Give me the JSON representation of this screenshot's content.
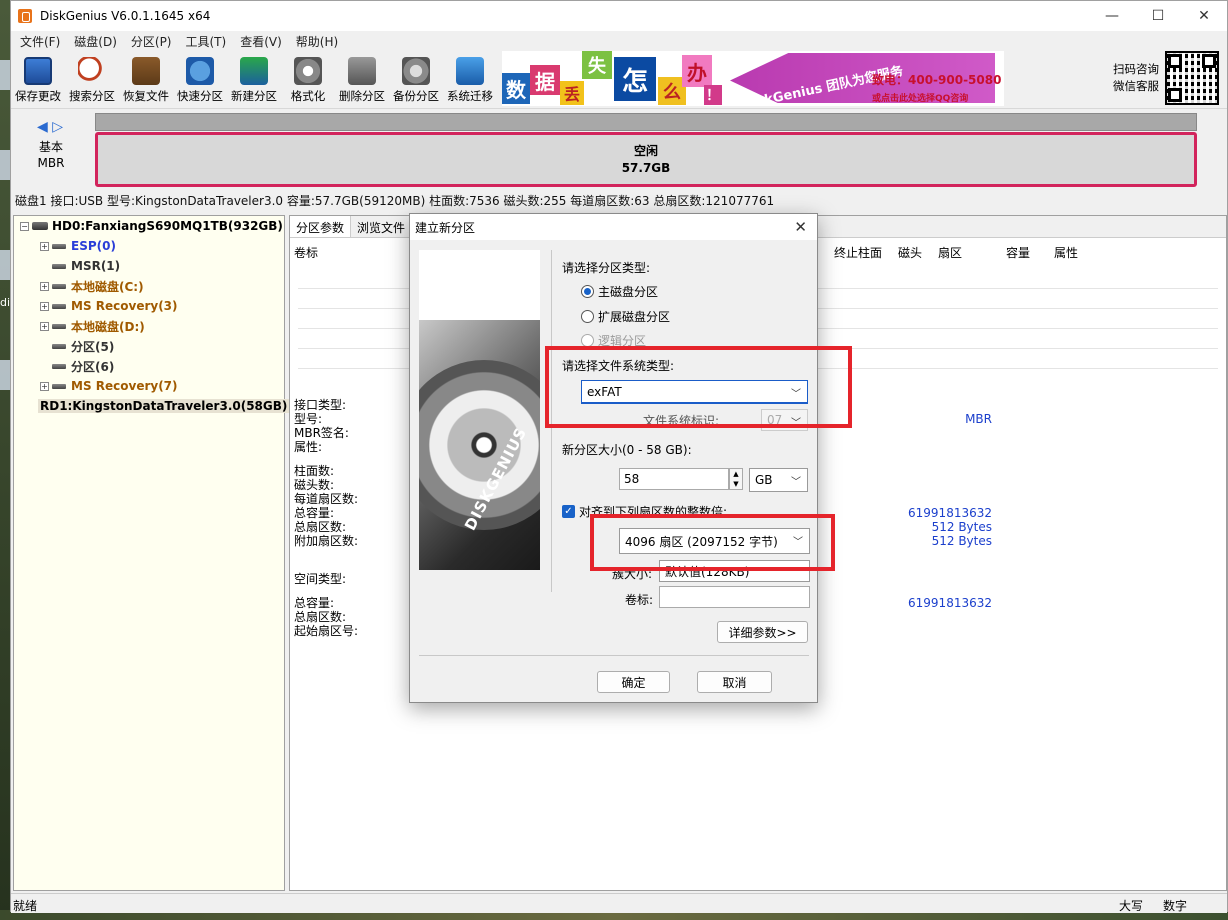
{
  "window": {
    "title": "DiskGenius V6.0.1.1645 x64"
  },
  "desktop": {
    "side_label": "di"
  },
  "window_buttons": {
    "minimize": "—",
    "maximize": "☐",
    "close": "✕"
  },
  "menu": [
    "文件(F)",
    "磁盘(D)",
    "分区(P)",
    "工具(T)",
    "查看(V)",
    "帮助(H)"
  ],
  "toolbar": [
    {
      "label": "保存更改",
      "icon": "save-icon"
    },
    {
      "label": "搜索分区",
      "icon": "search-icon"
    },
    {
      "label": "恢复文件",
      "icon": "recover-icon"
    },
    {
      "label": "快速分区",
      "icon": "quick-partition-icon"
    },
    {
      "label": "新建分区",
      "icon": "new-partition-icon"
    },
    {
      "label": "格式化",
      "icon": "format-icon"
    },
    {
      "label": "删除分区",
      "icon": "delete-icon"
    },
    {
      "label": "备份分区",
      "icon": "backup-icon"
    },
    {
      "label": "系统迁移",
      "icon": "migrate-icon"
    }
  ],
  "banner": {
    "chars": [
      "数",
      "据",
      "丢",
      "失",
      "怎",
      "么",
      "办",
      "！"
    ],
    "team": "DiskGenius 团队为您服务",
    "phone": "致电：400-900-5080",
    "qq": "或点击此处选择QQ咨询"
  },
  "qr": {
    "line1": "扫码咨询",
    "line2": "微信客服"
  },
  "diskmap": {
    "nav": "◀ ▷",
    "disk_type_line1": "基本",
    "disk_type_line2": "MBR",
    "free_label": "空闲",
    "free_size": "57.7GB"
  },
  "disk_info": "磁盘1 接口:USB  型号:KingstonDataTraveler3.0  容量:57.7GB(59120MB)  柱面数:7536  磁头数:255  每道扇区数:63  总扇区数:121077761",
  "tree": {
    "disk0": "HD0:FanxiangS690MQ1TB(932GB)",
    "partitions": [
      "ESP(0)",
      "MSR(1)",
      "本地磁盘(C:)",
      "MS Recovery(3)",
      "本地磁盘(D:)",
      "分区(5)",
      "分区(6)",
      "MS Recovery(7)"
    ],
    "disk1": "RD1:KingstonDataTraveler3.0(58GB)",
    "expander_plus": "+",
    "expander_minus": "−"
  },
  "right_panel": {
    "tabs": [
      "分区参数",
      "浏览文件"
    ],
    "columns": [
      "卷标",
      "终止柱面",
      "磁头",
      "扇区",
      "容量",
      "属性"
    ],
    "info_group1": [
      "接口类型:",
      "型号:",
      "MBR签名:",
      "属性:"
    ],
    "info_group2": [
      "柱面数:",
      "磁头数:",
      "每道扇区数:",
      "总容量:",
      "总扇区数:",
      "附加扇区数:"
    ],
    "space_type": "空间类型:",
    "info_group3": [
      "总容量:",
      "总扇区数:",
      "起始扇区号:"
    ],
    "values": {
      "mbr": "MBR",
      "total_bytes": "61991813632",
      "sector_size1": "512 Bytes",
      "sector_size2": "512 Bytes",
      "free_bytes": "61991813632"
    }
  },
  "status": {
    "left": "就绪",
    "caps": "大写",
    "num": "数字"
  },
  "dialog": {
    "title": "建立新分区",
    "close": "✕",
    "partition_type_label": "请选择分区类型:",
    "radios": [
      "主磁盘分区",
      "扩展磁盘分区",
      "逻辑分区"
    ],
    "fs_type_label": "请选择文件系统类型:",
    "fs_type_value": "exFAT",
    "fs_id_label": "文件系统标识:",
    "fs_id_value": "07",
    "size_label": "新分区大小(0 - 58 GB):",
    "size_value": "58",
    "size_unit": "GB",
    "align_label": "对齐到下列扇区数的整数倍:",
    "align_value": "4096 扇区 (2097152 字节)",
    "cluster_label": "簇大小:",
    "cluster_value": "默认值(128KB)",
    "volume_label": "卷标:",
    "volume_value": "",
    "details_button": "详细参数>>",
    "ok_button": "确定",
    "cancel_button": "取消",
    "image_text": "DISKGENIUS"
  },
  "colors": {
    "accent": "#1862c8",
    "highlight": "#e5242b",
    "free_border": "#d2245c"
  }
}
